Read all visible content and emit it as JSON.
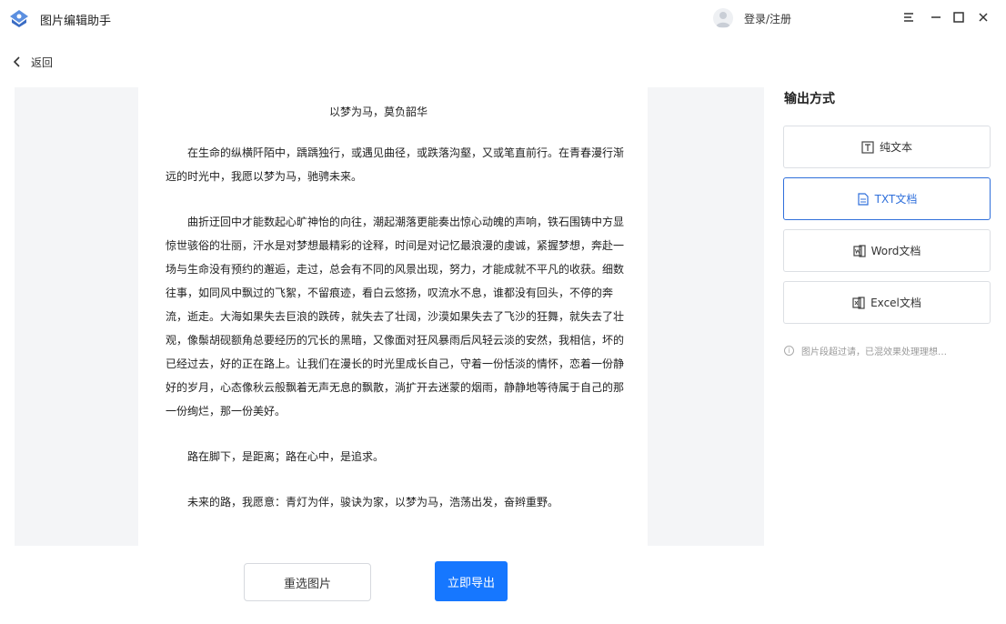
{
  "app": {
    "title": "图片编辑助手",
    "login": "登录/注册"
  },
  "nav": {
    "back": "返回"
  },
  "document": {
    "title": "以梦为马，莫负韶华",
    "paragraphs": [
      "在生命的纵横阡陌中，踽踽独行，或遇见曲径，或跌落沟壑，又或笔直前行。在青春漫行渐远的时光中，我愿以梦为马，驰骋未来。",
      "曲折迂回中才能数起心旷神怡的向往，潮起潮落更能奏出惊心动魄的声响，铁石围铸中方显惊世骇俗的壮丽，汗水是对梦想最精彩的诠释，时间是对记忆最浪漫的虔诚，紧握梦想，奔赴一场与生命没有预约的邂逅，走过，总会有不同的风景出现，努力，才能成就不平凡的收获。细数往事，如同风中飘过的飞絮，不留痕迹，看白云悠扬，叹流水不息，谁都没有回头，不停的奔流，逝走。大海如果失去巨浪的跌砖，就失去了壮阔，沙漠如果失去了飞沙的狂舞，就失去了壮观，像鬃胡砚额角总要经历的冗长的黑暗，又像面对狂风暴雨后风轻云淡的安然，我相信，坏的已经过去，好的正在路上。让我们在漫长的时光里成长自己，守着一份恬淡的情怀，恋着一份静好的岁月，心态像秋云般飘着无声无息的飘散，淌扩开去迷蒙的烟雨，静静地等待属于自己的那一份绚烂，那一份美好。",
      "路在脚下，是距离；路在心中，是追求。",
      "未来的路，我愿意：青灯为伴，骏诀为家，以梦为马，浩荡出发，奋辫重野。"
    ]
  },
  "sidebar": {
    "heading": "输出方式",
    "options": [
      {
        "label": "纯文本",
        "icon": "text-icon"
      },
      {
        "label": "TXT文档",
        "icon": "txt-doc-icon"
      },
      {
        "label": "Word文档",
        "icon": "word-icon"
      },
      {
        "label": "Excel文档",
        "icon": "excel-icon"
      }
    ],
    "selected_index": 1,
    "note": "图片段超过请，已混效果处理理想…"
  },
  "actions": {
    "reselect": "重选图片",
    "export": "立即导出"
  },
  "colors": {
    "accent": "#1677ff",
    "selected_border": "#2f6fdb"
  }
}
